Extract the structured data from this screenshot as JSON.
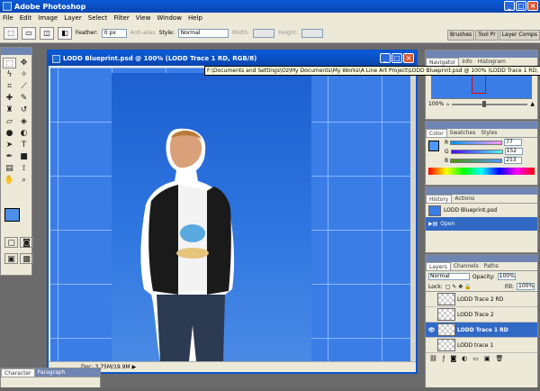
{
  "app": {
    "title": "Adobe Photoshop"
  },
  "menu": [
    "File",
    "Edit",
    "Image",
    "Layer",
    "Select",
    "Filter",
    "View",
    "Window",
    "Help"
  ],
  "options": {
    "feather_label": "Feather:",
    "feather_value": "0 px",
    "antialias_label": "Anti-alias",
    "style_label": "Style:",
    "style_value": "Normal",
    "width_label": "Width:",
    "height_label": "Height:"
  },
  "palette_well": [
    "Brushes",
    "Tool Pr",
    "Layer Comps"
  ],
  "document": {
    "title": "LODD Blueprint.psd @ 100% (LODD Trace 1 RD, RGB/8)",
    "tooltip": "F:\\Documents and Settings\\Oz\\My Documents\\My Works\\A Line Art Project\\LODD Blueprint.psd @ 100% (LODD Trace 1 RD, RGB/8)",
    "status": "Doc: 3.75M/19.9M"
  },
  "navigator": {
    "tabs": [
      "Navigator",
      "Info",
      "Histogram"
    ],
    "zoom": "100%"
  },
  "color": {
    "tabs": [
      "Color",
      "Swatches",
      "Styles"
    ],
    "r_label": "R",
    "r_value": "77",
    "g_label": "G",
    "g_value": "152",
    "b_label": "B",
    "b_value": "253",
    "fg_hex": "#4d98fd"
  },
  "history": {
    "tabs": [
      "History",
      "Actions"
    ],
    "items": [
      "LODD Blueprint.psd",
      "Open"
    ]
  },
  "layers": {
    "tabs": [
      "Layers",
      "Channels",
      "Paths"
    ],
    "blend_mode": "Normal",
    "opacity_label": "Opacity:",
    "opacity_value": "100%",
    "lock_label": "Lock:",
    "fill_label": "Fill:",
    "fill_value": "100%",
    "rows": [
      "LODD Trace 2 RD",
      "LODD Trace 2",
      "LODD Trace 1 RD",
      "LODD trace 1"
    ]
  },
  "character": {
    "tabs": [
      "Character",
      "Paragraph"
    ]
  }
}
